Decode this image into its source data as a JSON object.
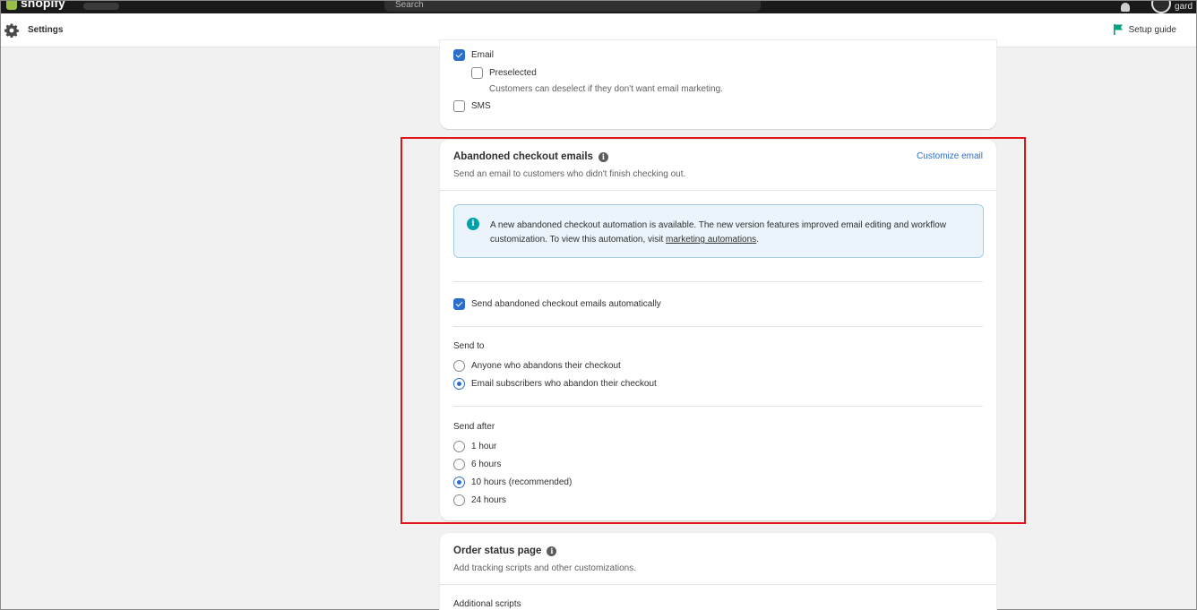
{
  "topbar": {
    "logo_text": "shopify",
    "search_placeholder": "Search",
    "avatar_label": "gard"
  },
  "header": {
    "title": "Settings",
    "setup_guide": "Setup guide"
  },
  "marketing_card": {
    "email_label": "Email",
    "email_checked": true,
    "preselected_label": "Preselected",
    "preselected_checked": false,
    "preselected_help": "Customers can deselect if they don't want email marketing.",
    "sms_label": "SMS",
    "sms_checked": false
  },
  "abandoned_card": {
    "title": "Abandoned checkout emails",
    "subtitle": "Send an email to customers who didn't finish checking out.",
    "customize_link": "Customize email",
    "banner_text": "A new abandoned checkout automation is available. The new version features improved email editing and workflow customization. To view this automation, visit ",
    "banner_link": "marketing automations",
    "banner_end": ".",
    "auto_send_label": "Send abandoned checkout emails automatically",
    "auto_send_checked": true,
    "send_to_label": "Send to",
    "send_to_options": [
      {
        "label": "Anyone who abandons their checkout",
        "selected": false
      },
      {
        "label": "Email subscribers who abandon their checkout",
        "selected": true
      }
    ],
    "send_after_label": "Send after",
    "send_after_options": [
      {
        "label": "1 hour",
        "selected": false
      },
      {
        "label": "6 hours",
        "selected": false
      },
      {
        "label": "10 hours (recommended)",
        "selected": true
      },
      {
        "label": "24 hours",
        "selected": false
      }
    ]
  },
  "order_status_card": {
    "title": "Order status page",
    "subtitle": "Add tracking scripts and other customizations.",
    "additional_scripts_label": "Additional scripts"
  },
  "colors": {
    "accent": "#2c6ecb",
    "highlight_border": "#e0161c",
    "banner_icon": "#00a0ac",
    "setup_flag": "#00a47c"
  }
}
